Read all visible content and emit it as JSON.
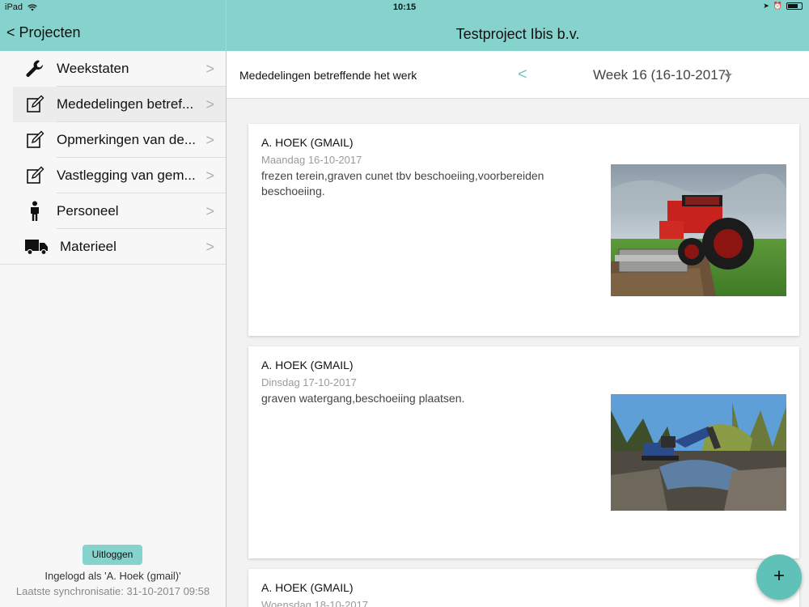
{
  "status": {
    "device": "iPad",
    "time": "10:15"
  },
  "nav": {
    "back_label": "< Projecten",
    "title": "Testproject Ibis b.v."
  },
  "sidebar": {
    "items": [
      {
        "label": "Weekstaten",
        "icon": "wrench-icon"
      },
      {
        "label": "Mededelingen betref...",
        "icon": "edit-note-icon"
      },
      {
        "label": "Opmerkingen van de...",
        "icon": "edit-note-icon"
      },
      {
        "label": "Vastlegging van gem...",
        "icon": "edit-note-icon"
      },
      {
        "label": "Personeel",
        "icon": "person-icon"
      },
      {
        "label": "Materieel",
        "icon": "truck-icon"
      }
    ],
    "logout_label": "Uitloggen",
    "logged_in_text": "Ingelogd als 'A. Hoek (gmail)'",
    "last_sync_text": "Laatste synchronisatie: 31-10-2017 09:58"
  },
  "main": {
    "header_title": "Mededelingen betreffende het werk",
    "prev_label": "<",
    "week_label": "Week 16 (16-10-2017)",
    "entries": [
      {
        "author": "A. HOEK (GMAIL)",
        "date": "Maandag 16-10-2017",
        "text": "frezen terein,graven cunet tbv beschoeiing,voorbereiden beschoeiing."
      },
      {
        "author": "A. HOEK (GMAIL)",
        "date": "Dinsdag 17-10-2017",
        "text": "graven watergang,beschoeiing plaatsen."
      },
      {
        "author": "A. HOEK (GMAIL)",
        "date": "Woensdag 18-10-2017",
        "text": ""
      }
    ],
    "add_label": "+"
  },
  "colors": {
    "accent": "#85d3cc",
    "fab": "#5fc1b8",
    "link": "#6fc8c0"
  }
}
